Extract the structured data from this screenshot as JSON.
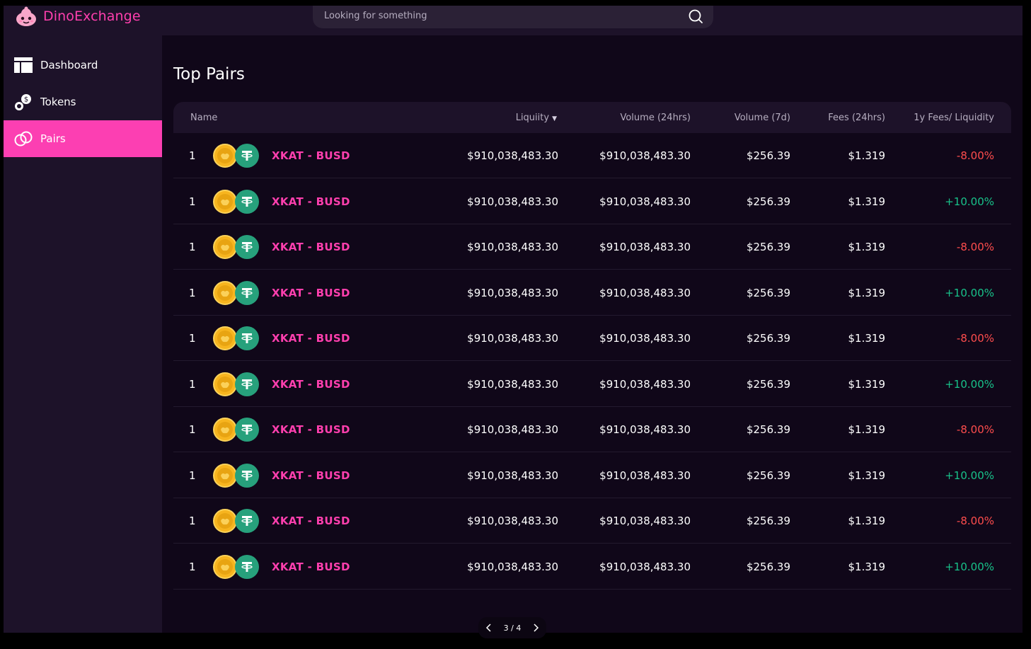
{
  "app": {
    "brand": "DinoExchange"
  },
  "search": {
    "placeholder": "Looking for something"
  },
  "sidebar": {
    "items": [
      {
        "label": "Dashboard",
        "icon": "dashboard-icon",
        "active": false
      },
      {
        "label": "Tokens",
        "icon": "tokens-icon",
        "active": false
      },
      {
        "label": "Pairs",
        "icon": "pairs-icon",
        "active": true
      }
    ]
  },
  "page": {
    "title": "Top Pairs"
  },
  "table": {
    "headers": {
      "name": "Name",
      "liquidity": "Liquiity",
      "vol24": "Volume (24hrs)",
      "vol7": "Volume (7d)",
      "fees": "Fees (24hrs)",
      "ratio": "1y Fees/ Liquidity"
    },
    "rows": [
      {
        "rank": "1",
        "pair": "XKAT - BUSD",
        "liquidity": "$910,038,483.30",
        "vol24": "$910,038,483.30",
        "vol7": "$256.39",
        "fees": "$1.319",
        "ratio": "-8.00%"
      },
      {
        "rank": "1",
        "pair": "XKAT - BUSD",
        "liquidity": "$910,038,483.30",
        "vol24": "$910,038,483.30",
        "vol7": "$256.39",
        "fees": "$1.319",
        "ratio": "+10.00%"
      },
      {
        "rank": "1",
        "pair": "XKAT - BUSD",
        "liquidity": "$910,038,483.30",
        "vol24": "$910,038,483.30",
        "vol7": "$256.39",
        "fees": "$1.319",
        "ratio": "-8.00%"
      },
      {
        "rank": "1",
        "pair": "XKAT - BUSD",
        "liquidity": "$910,038,483.30",
        "vol24": "$910,038,483.30",
        "vol7": "$256.39",
        "fees": "$1.319",
        "ratio": "+10.00%"
      },
      {
        "rank": "1",
        "pair": "XKAT - BUSD",
        "liquidity": "$910,038,483.30",
        "vol24": "$910,038,483.30",
        "vol7": "$256.39",
        "fees": "$1.319",
        "ratio": "-8.00%"
      },
      {
        "rank": "1",
        "pair": "XKAT - BUSD",
        "liquidity": "$910,038,483.30",
        "vol24": "$910,038,483.30",
        "vol7": "$256.39",
        "fees": "$1.319",
        "ratio": "+10.00%"
      },
      {
        "rank": "1",
        "pair": "XKAT - BUSD",
        "liquidity": "$910,038,483.30",
        "vol24": "$910,038,483.30",
        "vol7": "$256.39",
        "fees": "$1.319",
        "ratio": "-8.00%"
      },
      {
        "rank": "1",
        "pair": "XKAT - BUSD",
        "liquidity": "$910,038,483.30",
        "vol24": "$910,038,483.30",
        "vol7": "$256.39",
        "fees": "$1.319",
        "ratio": "+10.00%"
      },
      {
        "rank": "1",
        "pair": "XKAT - BUSD",
        "liquidity": "$910,038,483.30",
        "vol24": "$910,038,483.30",
        "vol7": "$256.39",
        "fees": "$1.319",
        "ratio": "-8.00%"
      },
      {
        "rank": "1",
        "pair": "XKAT - BUSD",
        "liquidity": "$910,038,483.30",
        "vol24": "$910,038,483.30",
        "vol7": "$256.39",
        "fees": "$1.319",
        "ratio": "+10.00%"
      }
    ]
  },
  "pagination": {
    "label": "3 / 4"
  },
  "colors": {
    "accent": "#fc3fb2",
    "negative": "#ff4d4d",
    "positive": "#18c28a",
    "background": "#100719",
    "panel": "#1d1229"
  }
}
